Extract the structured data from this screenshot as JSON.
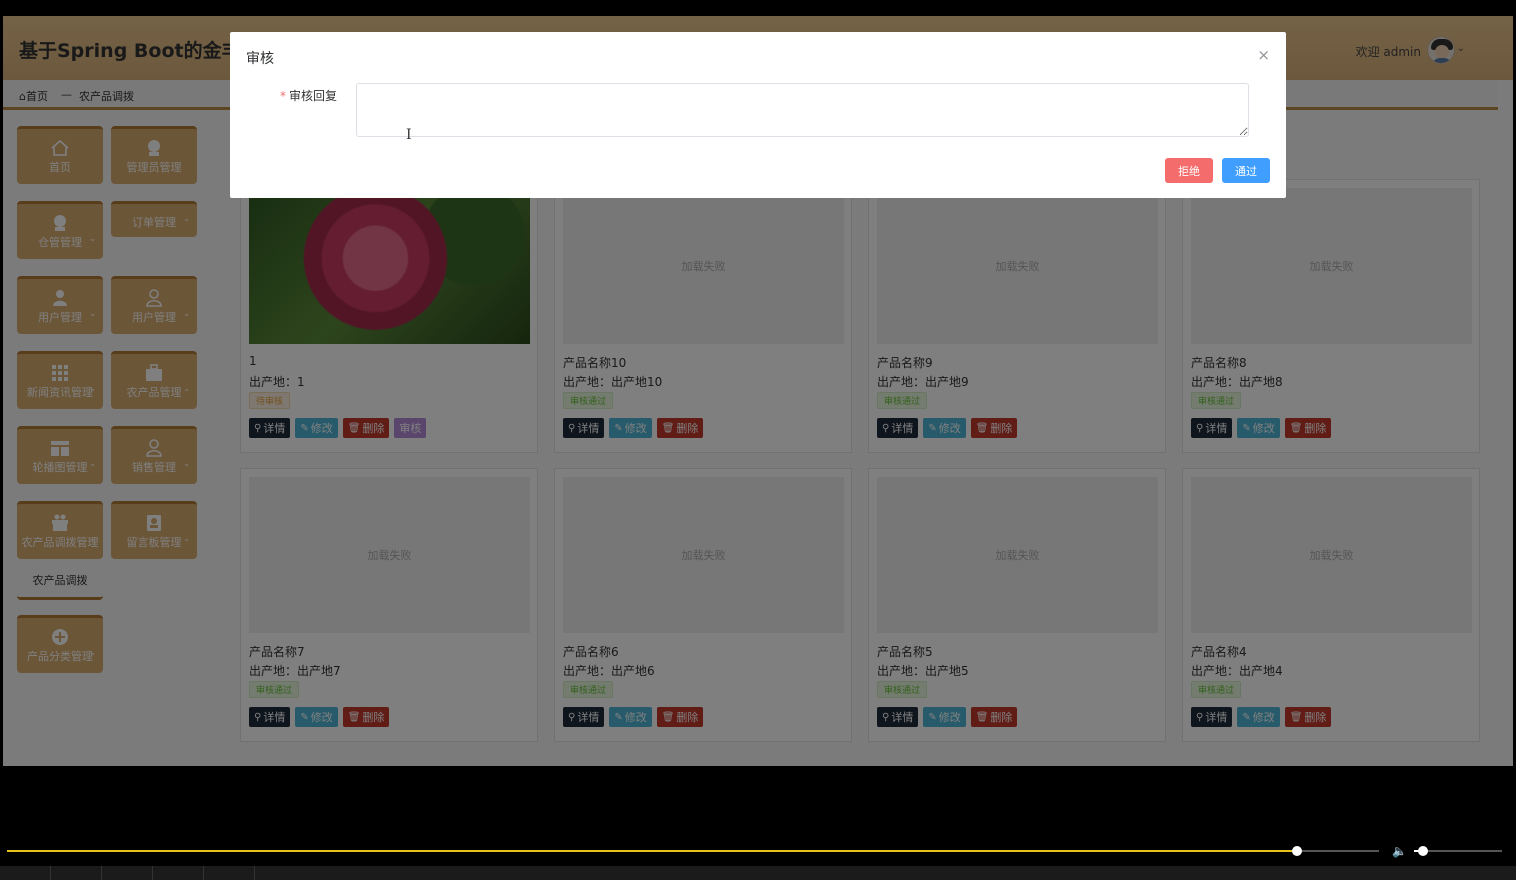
{
  "app": {
    "title": "基于Spring Boot的金丰町",
    "welcome": "欢迎 admin",
    "avatar_caret": "⌄"
  },
  "breadcrumb": {
    "home": "⌂首页",
    "separator": "—",
    "current": "农产品调拨"
  },
  "sidebar": {
    "items": [
      {
        "label": "首页",
        "icon": "home-icon",
        "caret": ""
      },
      {
        "label": "管理员管理",
        "icon": "admin-icon",
        "caret": ""
      },
      {
        "label": "仓管管理",
        "icon": "admin-icon",
        "caret": "⌄"
      },
      {
        "label": "订单管理",
        "icon": "order-icon",
        "caret": "⌄"
      },
      {
        "label": "用户管理",
        "icon": "user-icon",
        "caret": "⌄"
      },
      {
        "label": "用户管理",
        "icon": "user-outline-icon",
        "caret": "⌄"
      },
      {
        "label": "新闻资讯管理",
        "icon": "grid-icon",
        "caret": "⌄"
      },
      {
        "label": "农产品管理",
        "icon": "briefcase-icon",
        "caret": "⌄"
      },
      {
        "label": "轮播图管理",
        "icon": "carousel-icon",
        "caret": "⌄"
      },
      {
        "label": "销售管理",
        "icon": "user-outline-icon",
        "caret": "⌄"
      },
      {
        "label": "农产品调拨管理",
        "icon": "gift-icon",
        "caret": "⌄"
      },
      {
        "label": "留言板管理",
        "icon": "board-icon",
        "caret": "⌄"
      },
      {
        "label": "产品分类管理",
        "icon": "plus-circle-icon",
        "caret": "⌄"
      }
    ],
    "sub_item": "农产品调拨"
  },
  "cards": [
    {
      "name": "1",
      "origin": "出产地：1",
      "status": "待审核",
      "status_type": "wait",
      "image": "rose",
      "has_audit": true
    },
    {
      "name": "产品名称10",
      "origin": "出产地：出产地10",
      "status": "审核通过",
      "status_type": "ok",
      "image": "failed",
      "has_audit": false
    },
    {
      "name": "产品名称9",
      "origin": "出产地：出产地9",
      "status": "审核通过",
      "status_type": "ok",
      "image": "failed",
      "has_audit": false
    },
    {
      "name": "产品名称8",
      "origin": "出产地：出产地8",
      "status": "审核通过",
      "status_type": "ok",
      "image": "failed",
      "has_audit": false
    },
    {
      "name": "产品名称7",
      "origin": "出产地：出产地7",
      "status": "审核通过",
      "status_type": "ok",
      "image": "failed",
      "has_audit": false
    },
    {
      "name": "产品名称6",
      "origin": "出产地：出产地6",
      "status": "审核通过",
      "status_type": "ok",
      "image": "failed",
      "has_audit": false
    },
    {
      "name": "产品名称5",
      "origin": "出产地：出产地5",
      "status": "审核通过",
      "status_type": "ok",
      "image": "failed",
      "has_audit": false
    },
    {
      "name": "产品名称4",
      "origin": "出产地：出产地4",
      "status": "审核通过",
      "status_type": "ok",
      "image": "failed",
      "has_audit": false
    }
  ],
  "card_labels": {
    "image_failed": "加载失败",
    "detail": "详情",
    "edit": "修改",
    "delete": "删除",
    "audit": "审核"
  },
  "modal": {
    "title": "审核",
    "close": "×",
    "reply_label": "审核回复",
    "required_mark": "*",
    "reply_value": "",
    "reject": "拒绝",
    "pass": "通过"
  },
  "video": {
    "progress": 0.94,
    "volume": 0.1
  },
  "colors": {
    "header": "#d9b27a",
    "tile": "#d8ad70",
    "reject": "#f56c6c",
    "pass": "#409eff",
    "seek": "#e8c21a"
  }
}
